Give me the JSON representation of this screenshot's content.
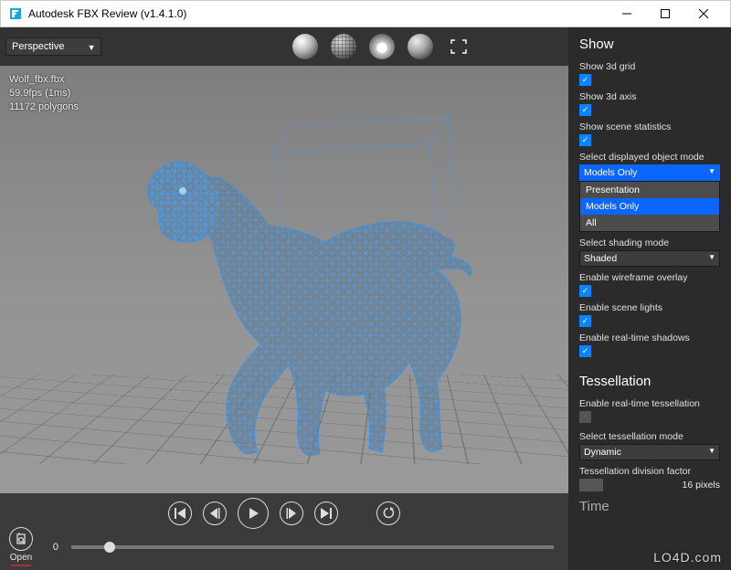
{
  "window": {
    "title": "Autodesk FBX Review (v1.4.1.0)"
  },
  "viewSelector": {
    "value": "Perspective"
  },
  "stats": {
    "filename": "Wolf_fbx.fbx",
    "fps": "59.9fps (1ms)",
    "polygons": "11172 polygons"
  },
  "playback": {
    "openLabel": "Open",
    "frame": "0"
  },
  "side": {
    "showHeader": "Show",
    "show3dGrid": "Show 3d grid",
    "show3dAxis": "Show 3d axis",
    "showStats": "Show scene statistics",
    "selectObjMode": "Select displayed object mode",
    "objModeValue": "Models Only",
    "objModeOptions": [
      "Presentation",
      "Models Only",
      "All"
    ],
    "selectShading": "Select shading mode",
    "shadingValue": "Shaded",
    "wireframe": "Enable wireframe overlay",
    "sceneLights": "Enable scene lights",
    "shadows": "Enable real-time shadows",
    "tessHeader": "Tessellation",
    "tessEnable": "Enable real-time tessellation",
    "tessMode": "Select tessellation mode",
    "tessModeValue": "Dynamic",
    "tessDiv": "Tessellation division factor",
    "tessDivValue": "16 pixels",
    "timeHeader": "Time"
  },
  "watermark": "LO4D.com"
}
